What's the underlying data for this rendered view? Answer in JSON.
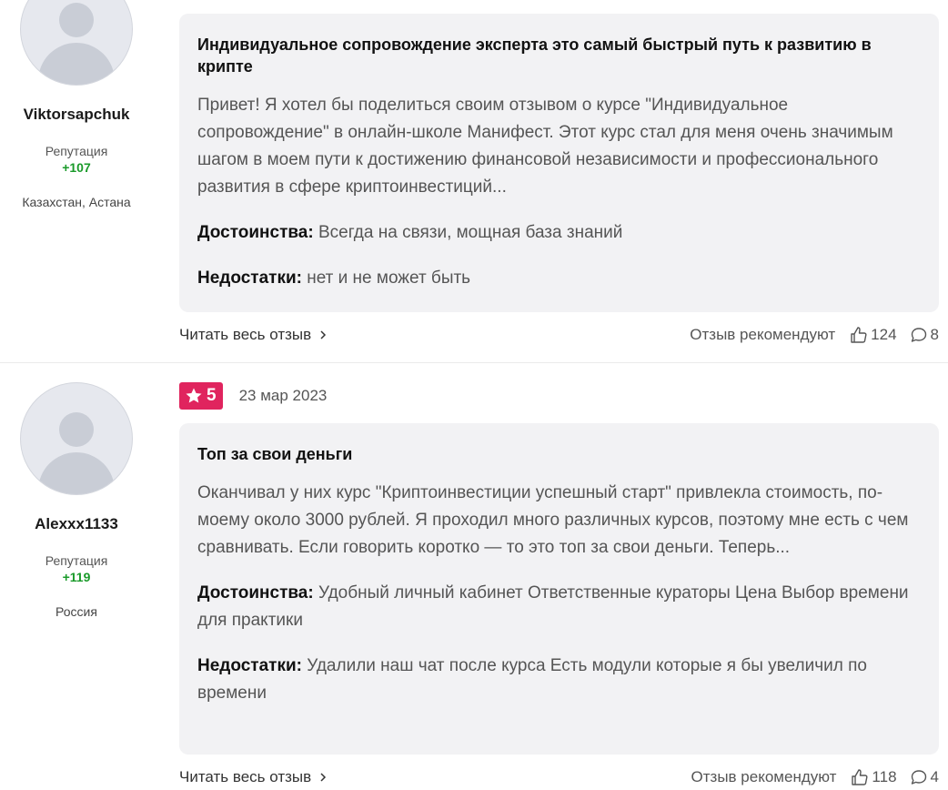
{
  "reviews": [
    {
      "author": {
        "name": "Viktorsapchuk",
        "reputation_label": "Репутация",
        "reputation_value": "+107",
        "location": "Казахстан, Астана"
      },
      "title": "Индивидуальное сопровождение эксперта это самый быстрый путь к развитию в крипте",
      "text": "Привет! Я хотел бы поделиться своим отзывом о курсе \"Индивидуальное сопровождение\" в онлайн-школе Манифест. Этот курс стал для меня очень значимым шагом в моем пути к достижению финансовой независимости и профессионального развития в сфере криптоинвестиций...",
      "pros_label": "Достоинства:",
      "pros": "Всегда на связи, мощная база знаний",
      "cons_label": "Недостатки:",
      "cons": "нет и не может быть",
      "read_more": "Читать весь отзыв",
      "recommend_label": "Отзыв рекомендуют",
      "likes": "124",
      "comments": "8"
    },
    {
      "author": {
        "name": "Alexxx1133",
        "reputation_label": "Репутация",
        "reputation_value": "+119",
        "location": "Россия"
      },
      "rating": "5",
      "date": "23 мар 2023",
      "title": "Топ за свои деньги",
      "text": "Оканчивал у них курс \"Криптоинвестиции успешный старт\" привлекла стоимость, по-моему около 3000 рублей. Я проходил много различных курсов, поэтому мне есть с чем сравнивать. Если говорить коротко — то это топ за свои деньги. Теперь...",
      "pros_label": "Достоинства:",
      "pros": "Удобный личный кабинет Ответственные кураторы Цена Выбор времени для практики",
      "cons_label": "Недостатки:",
      "cons": "Удалили наш чат после курса Есть модули которые я бы увеличил по времени",
      "read_more": "Читать весь отзыв",
      "recommend_label": "Отзыв рекомендуют",
      "likes": "118",
      "comments": "4"
    }
  ],
  "colors": {
    "rating_badge": "#e0245e",
    "reputation": "#1a9a2a",
    "card_bg": "#f2f2f4"
  },
  "icons": [
    "star-icon",
    "chevron-right-icon",
    "thumbs-up-icon",
    "comment-icon",
    "avatar-placeholder-icon"
  ]
}
